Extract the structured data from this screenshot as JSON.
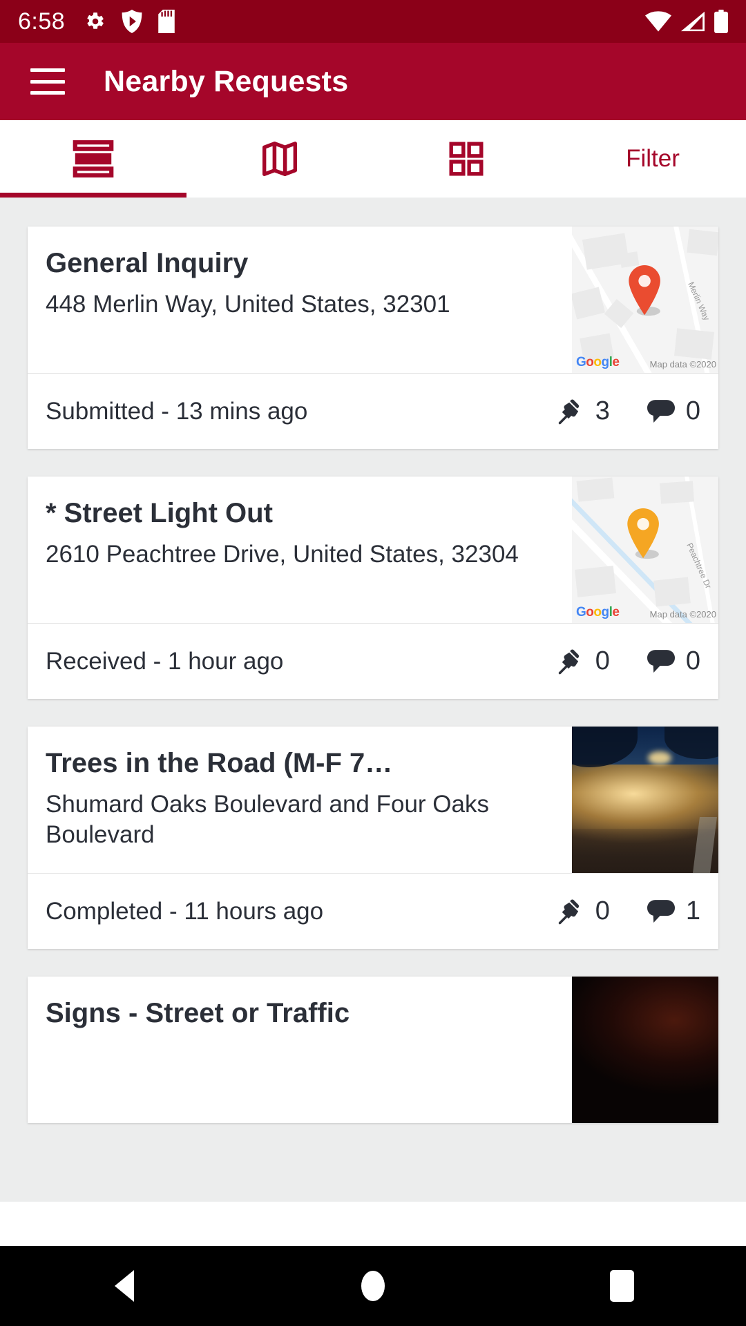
{
  "status_bar": {
    "time": "6:58",
    "left_icons": [
      "settings-gear-icon",
      "shield-icon",
      "sd-card-icon"
    ],
    "right_icons": [
      "wifi-icon",
      "cellular-signal-icon",
      "battery-icon"
    ]
  },
  "app_bar": {
    "menu_icon": "hamburger-menu-icon",
    "title": "Nearby Requests"
  },
  "tabs": [
    {
      "name": "list-tab",
      "icon": "list-view-icon",
      "label": "",
      "active": true
    },
    {
      "name": "map-tab",
      "icon": "map-view-icon",
      "label": "",
      "active": false
    },
    {
      "name": "grid-tab",
      "icon": "grid-view-icon",
      "label": "",
      "active": false
    },
    {
      "name": "filter-tab",
      "icon": "",
      "label": "Filter",
      "active": false
    }
  ],
  "colors": {
    "status_bar": "#8b0018",
    "app_bar": "#a5062a",
    "accent": "#a5062a",
    "page_bg": "#eceded",
    "card_bg": "#ffffff",
    "text": "#2b2f38",
    "pin_red": "#ea4c30",
    "pin_orange": "#f5a623"
  },
  "requests": [
    {
      "title": "General Inquiry",
      "address": "448   Merlin Way, United States, 32301",
      "status": "Submitted - 13 mins ago",
      "pin_count": "3",
      "comment_count": "0",
      "thumb_type": "map",
      "map_pin_color": "#ea4c30",
      "map_street_label": "Merlin Way",
      "map_attribution": "Map data ©2020",
      "map_watermark": "Google"
    },
    {
      "title": "* Street Light Out",
      "address": "2610   Peachtree Drive, United States, 32304",
      "status": "Received - 1 hour ago",
      "pin_count": "0",
      "comment_count": "0",
      "thumb_type": "map",
      "map_pin_color": "#f5a623",
      "map_street_label": "Peachtree Dr",
      "map_attribution": "Map data ©2020",
      "map_watermark": "Google"
    },
    {
      "title": "Trees in the Road (M-F 7…",
      "address": "Shumard Oaks Boulevard and Four Oaks Boulevard",
      "status": "Completed - 11 hours ago",
      "pin_count": "0",
      "comment_count": "1",
      "thumb_type": "photo",
      "photo_description": "night-fallen-tree-photo"
    },
    {
      "title": "Signs - Street or Traffic",
      "address": "",
      "status": "",
      "pin_count": "",
      "comment_count": "",
      "thumb_type": "photo",
      "photo_description": "dark-night-photo"
    }
  ],
  "nav_bar": {
    "back": "back-nav-button",
    "home": "home-nav-button",
    "recents": "recents-nav-button"
  }
}
